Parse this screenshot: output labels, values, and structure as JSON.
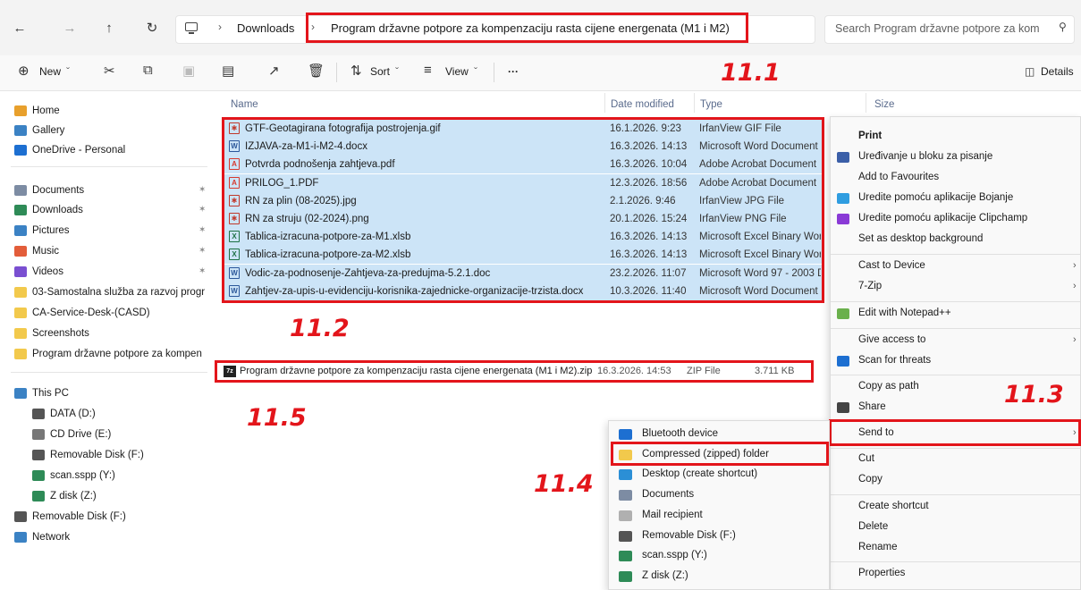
{
  "address_bar": {
    "back_icon": "arrow-left-icon",
    "forward_icon": "arrow-right-icon",
    "up_icon": "arrow-up-icon",
    "refresh_icon": "refresh-icon",
    "pc_icon": "monitor-icon",
    "breadcrumbs": [
      "Downloads",
      "Program državne potpore za kompenzaciju rasta cijene energenata (M1 i M2)"
    ],
    "search_placeholder": "Search Program državne potpore za kom"
  },
  "command_bar": {
    "new": "New",
    "sort": "Sort",
    "view": "View",
    "more": "···",
    "details": "Details"
  },
  "sidebar": {
    "quick": [
      {
        "label": "Home",
        "icon": "home-icon",
        "color": "#e8a02c"
      },
      {
        "label": "Gallery",
        "icon": "gallery-icon",
        "color": "#3b82c4"
      },
      {
        "label": "OneDrive - Personal",
        "icon": "cloud-icon",
        "color": "#1d6fd1"
      }
    ],
    "pinned": [
      {
        "label": "Documents",
        "icon": "documents-icon",
        "color": "#7d8ca3",
        "pinned": true
      },
      {
        "label": "Downloads",
        "icon": "download-icon",
        "color": "#2e8b57",
        "pinned": true
      },
      {
        "label": "Pictures",
        "icon": "pictures-icon",
        "color": "#3b82c4",
        "pinned": true
      },
      {
        "label": "Music",
        "icon": "music-icon",
        "color": "#e35d3a",
        "pinned": true
      },
      {
        "label": "Videos",
        "icon": "videos-icon",
        "color": "#7a4fd1",
        "pinned": true
      },
      {
        "label": "03-Samostalna služba za razvoj progr",
        "icon": "folder-icon",
        "color": "#f2c94c",
        "pinned": false
      },
      {
        "label": "CA-Service-Desk-(CASD)",
        "icon": "folder-icon",
        "color": "#f2c94c",
        "pinned": false
      },
      {
        "label": "Screenshots",
        "icon": "folder-icon",
        "color": "#f2c94c",
        "pinned": false
      },
      {
        "label": "Program državne potpore za kompen",
        "icon": "folder-icon",
        "color": "#f2c94c",
        "pinned": false
      }
    ],
    "devices": [
      {
        "label": "This PC",
        "icon": "this-pc-icon",
        "color": "#3b82c4",
        "indent": 0
      },
      {
        "label": "DATA (D:)",
        "icon": "drive-icon",
        "color": "#555555",
        "indent": 1
      },
      {
        "label": "CD Drive (E:)",
        "icon": "cd-drive-icon",
        "color": "#777777",
        "indent": 1
      },
      {
        "label": "Removable Disk (F:)",
        "icon": "drive-icon",
        "color": "#555555",
        "indent": 1
      },
      {
        "label": "scan.sspp (Y:)",
        "icon": "network-drive-icon",
        "color": "#2e8b57",
        "indent": 1
      },
      {
        "label": "Z disk (Z:)",
        "icon": "network-drive-icon",
        "color": "#2e8b57",
        "indent": 1
      },
      {
        "label": "Removable Disk (F:)",
        "icon": "drive-icon",
        "color": "#555555",
        "indent": 0
      },
      {
        "label": "Network",
        "icon": "network-icon",
        "color": "#3b82c4",
        "indent": 0
      }
    ]
  },
  "columns": {
    "name": "Name",
    "date": "Date modified",
    "type": "Type",
    "size": "Size"
  },
  "files": [
    {
      "name": "GTF-Geotagirana fotografija postrojenja.gif",
      "date": "16.1.2026. 9:23",
      "type": "IrfanView GIF File",
      "icon": "irfanview-icon",
      "color": "#c0392b"
    },
    {
      "name": "IZJAVA-za-M1-i-M2-4.docx",
      "date": "16.3.2026. 14:13",
      "type": "Microsoft Word Document",
      "icon": "word-icon",
      "color": "#2b579a"
    },
    {
      "name": "Potvrda podnošenja zahtjeva.pdf",
      "date": "16.3.2026. 10:04",
      "type": "Adobe Acrobat Document",
      "icon": "pdf-icon",
      "color": "#d63a2f"
    },
    {
      "name": "PRILOG_1.PDF",
      "date": "12.3.2026. 18:56",
      "type": "Adobe Acrobat Document",
      "icon": "pdf-icon",
      "color": "#d63a2f"
    },
    {
      "name": "RN za plin (08-2025).jpg",
      "date": "2.1.2026. 9:46",
      "type": "IrfanView JPG File",
      "icon": "irfanview-icon",
      "color": "#c0392b"
    },
    {
      "name": "RN za struju (02-2024).png",
      "date": "20.1.2026. 15:24",
      "type": "IrfanView PNG File",
      "icon": "irfanview-icon",
      "color": "#c0392b"
    },
    {
      "name": "Tablica-izracuna-potpore-za-M1.xlsb",
      "date": "16.3.2026. 14:13",
      "type": "Microsoft Excel Binary Work",
      "icon": "excel-icon",
      "color": "#1e7145"
    },
    {
      "name": "Tablica-izracuna-potpore-za-M2.xlsb",
      "date": "16.3.2026. 14:13",
      "type": "Microsoft Excel Binary Work",
      "icon": "excel-icon",
      "color": "#1e7145"
    },
    {
      "name": "Vodic-za-podnosenje-Zahtjeva-za-predujma-5.2.1.doc",
      "date": "23.2.2026. 11:07",
      "type": "Microsoft Word 97 - 2003 Do",
      "icon": "word-icon",
      "color": "#2b579a"
    },
    {
      "name": "Zahtjev-za-upis-u-evidenciju-korisnika-zajednicke-organizacije-trzista.docx",
      "date": "10.3.2026. 11:40",
      "type": "Microsoft Word Document",
      "icon": "word-icon",
      "color": "#2b579a"
    }
  ],
  "zip_file": {
    "name": "Program državne potpore za kompenzaciju rasta cijene energenata (M1 i M2).zip",
    "date": "16.3.2026. 14:53",
    "type": "ZIP File",
    "size": "3.711 KB",
    "icon": "7zip-icon"
  },
  "context_menu": {
    "items": [
      {
        "label": "Print",
        "bold": true,
        "icon": null,
        "arrow": false
      },
      {
        "label": "Uređivanje u bloku za pisanje",
        "icon": "notepad-icon",
        "color": "#3b5fa8",
        "arrow": false
      },
      {
        "label": "Add to Favourites",
        "icon": null,
        "arrow": false
      },
      {
        "label": "Uredite pomoću aplikacije Bojanje",
        "icon": "paint-icon",
        "color": "#2f9de0",
        "arrow": false
      },
      {
        "label": "Uredite pomoću aplikacije Clipchamp",
        "icon": "clipchamp-icon",
        "color": "#8a3ad6",
        "arrow": false
      },
      {
        "label": "Set as desktop background",
        "icon": null,
        "arrow": false
      },
      {
        "label": "Cast to Device",
        "icon": null,
        "arrow": true
      },
      {
        "label": "7-Zip",
        "icon": null,
        "arrow": true
      },
      {
        "label": "Edit with Notepad++",
        "icon": "notepadpp-icon",
        "color": "#6ab04c",
        "arrow": false
      },
      {
        "label": "Give access to",
        "icon": null,
        "arrow": true
      },
      {
        "label": "Scan for threats",
        "icon": "defender-icon",
        "color": "#1d6fd1",
        "arrow": false
      },
      {
        "label": "Copy as path",
        "icon": null,
        "arrow": false
      },
      {
        "label": "Share",
        "icon": "share-icon",
        "color": "#444444",
        "arrow": false
      },
      {
        "label": "Send to",
        "icon": null,
        "arrow": true
      },
      {
        "label": "Cut",
        "icon": null,
        "arrow": false
      },
      {
        "label": "Copy",
        "icon": null,
        "arrow": false
      },
      {
        "label": "Create shortcut",
        "icon": null,
        "arrow": false
      },
      {
        "label": "Delete",
        "icon": null,
        "arrow": false
      },
      {
        "label": "Rename",
        "icon": null,
        "arrow": false
      },
      {
        "label": "Properties",
        "icon": null,
        "arrow": false
      }
    ]
  },
  "send_to_menu": {
    "items": [
      {
        "label": "Bluetooth device",
        "icon": "bluetooth-icon",
        "color": "#1d6fd1"
      },
      {
        "label": "Compressed (zipped) folder",
        "icon": "zip-folder-icon",
        "color": "#f2c94c"
      },
      {
        "label": "Desktop (create shortcut)",
        "icon": "desktop-icon",
        "color": "#2b8fd6"
      },
      {
        "label": "Documents",
        "icon": "documents-icon",
        "color": "#7d8ca3"
      },
      {
        "label": "Mail recipient",
        "icon": "mail-icon",
        "color": "#b0b0b0"
      },
      {
        "label": "Removable Disk (F:)",
        "icon": "drive-icon",
        "color": "#555555"
      },
      {
        "label": "scan.sspp (Y:)",
        "icon": "network-drive-icon",
        "color": "#2e8b57"
      },
      {
        "label": "Z disk (Z:)",
        "icon": "network-drive-icon",
        "color": "#2e8b57"
      }
    ]
  },
  "annotations": {
    "l1": "11.1",
    "l2": "11.2",
    "l3": "11.3",
    "l4": "11.4",
    "l5": "11.5",
    "color": "#e3151b"
  }
}
